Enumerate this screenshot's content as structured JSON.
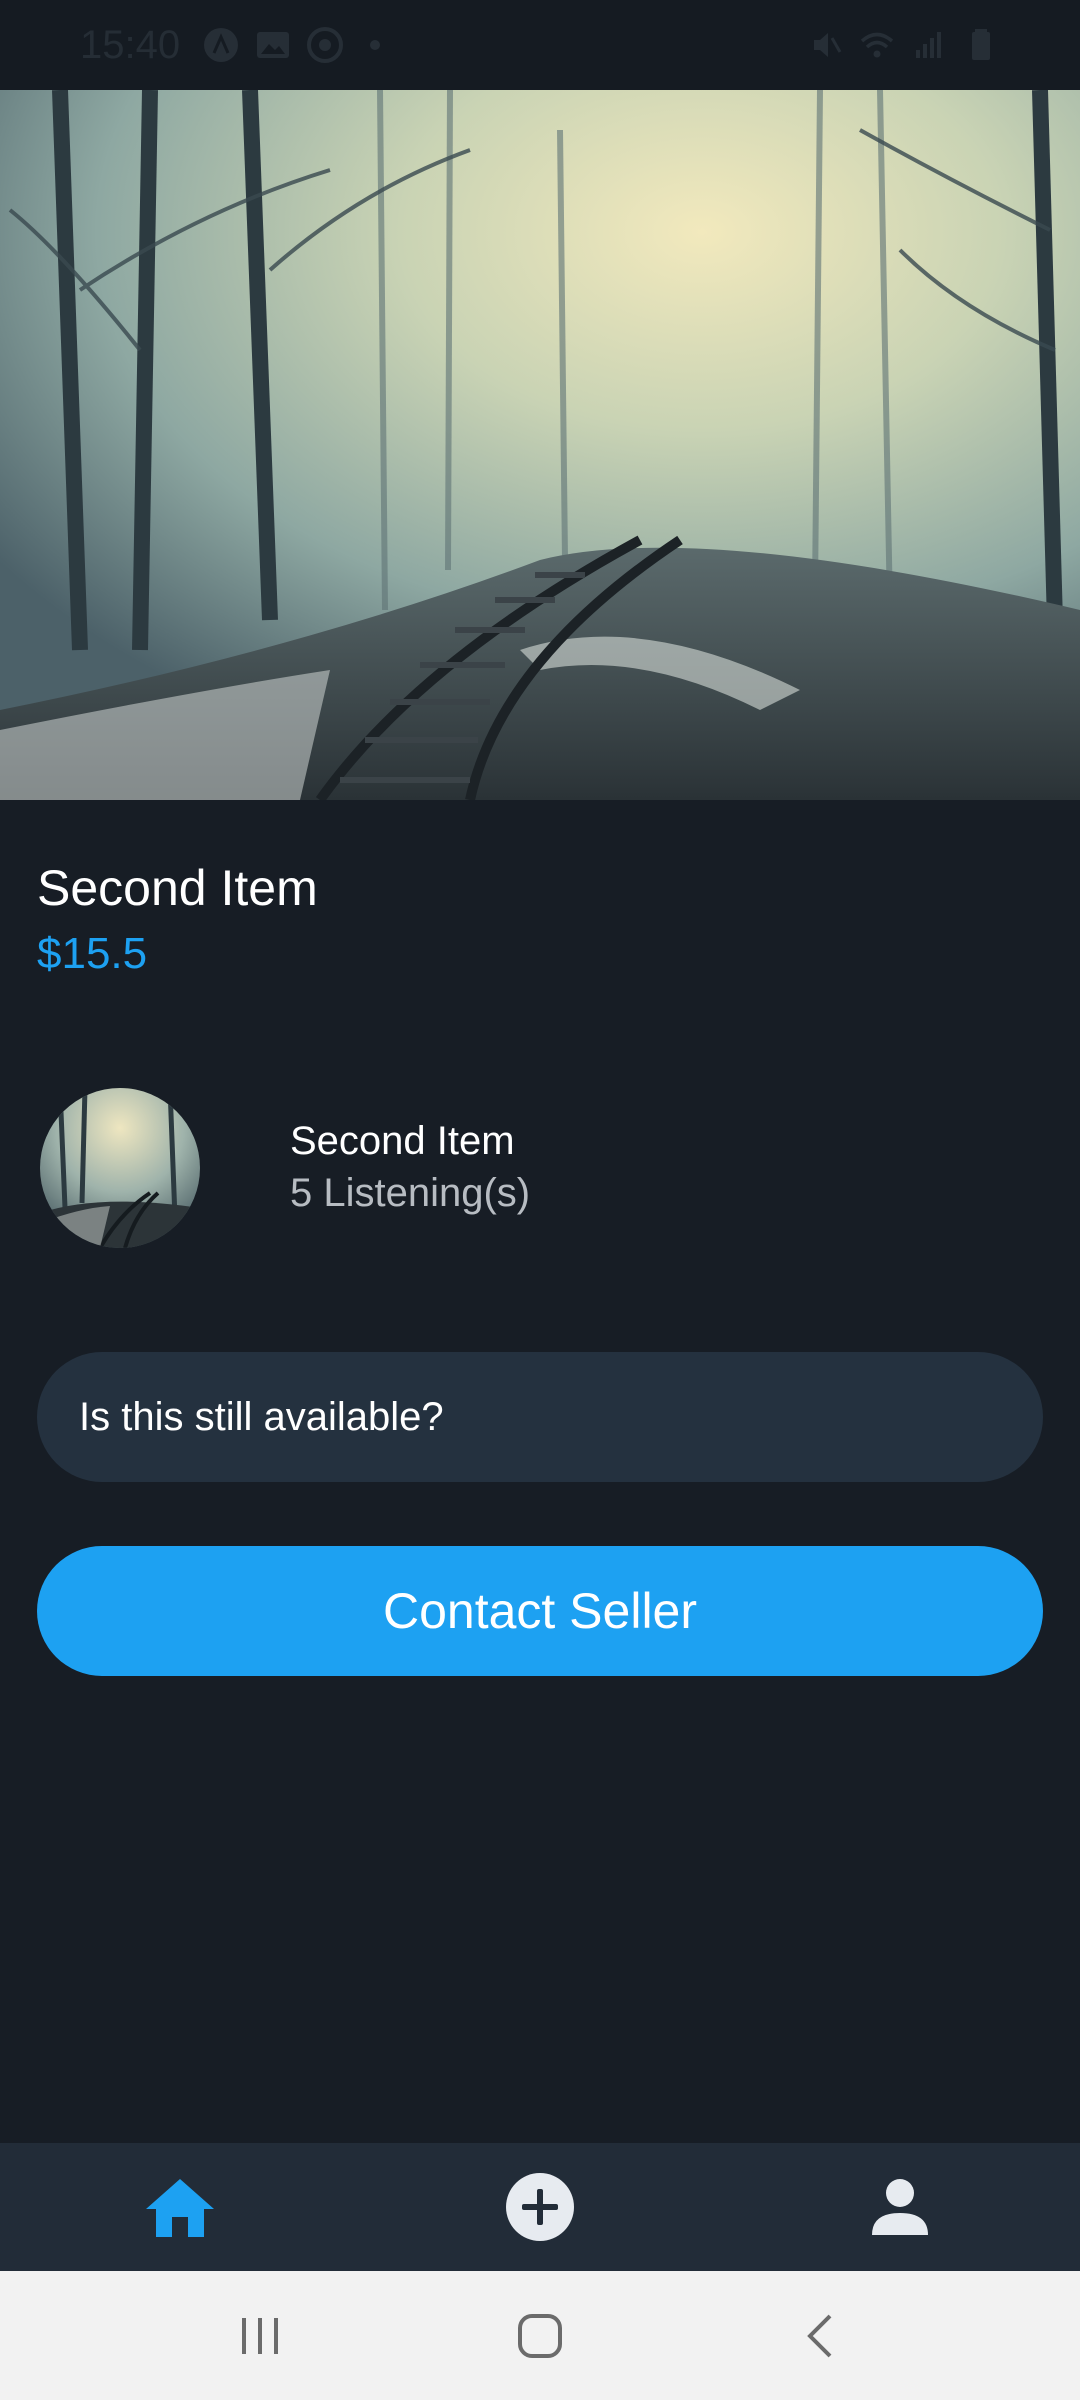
{
  "status_bar": {
    "time": "15:40",
    "icons_left": [
      "app-icon",
      "gallery-icon",
      "vpn-icon",
      "notification-dot"
    ],
    "icons_right": [
      "mute-icon",
      "wifi-icon",
      "signal-icon",
      "battery-icon"
    ]
  },
  "product": {
    "image": "foggy-forest-railway-photo",
    "title": "Second Item",
    "price": "$15.5"
  },
  "seller": {
    "avatar": "foggy-forest-railway-thumbnail",
    "name": "Second Item",
    "listings": "5 Listening(s)"
  },
  "message": {
    "text": "Is this still available?"
  },
  "contact_button": {
    "label": "Contact Seller"
  },
  "tab_bar": {
    "tabs": [
      {
        "icon": "home-icon",
        "active": true
      },
      {
        "icon": "add-icon",
        "active": false
      },
      {
        "icon": "account-icon",
        "active": false
      }
    ]
  },
  "system_nav": {
    "buttons": [
      "recents-icon",
      "home-button-icon",
      "back-icon"
    ]
  },
  "colors": {
    "background": "#171d25",
    "accent": "#1da1f2",
    "input_bg": "#24313f",
    "tab_bar_bg": "#222c38",
    "secondary_text": "#b7bcc2"
  }
}
